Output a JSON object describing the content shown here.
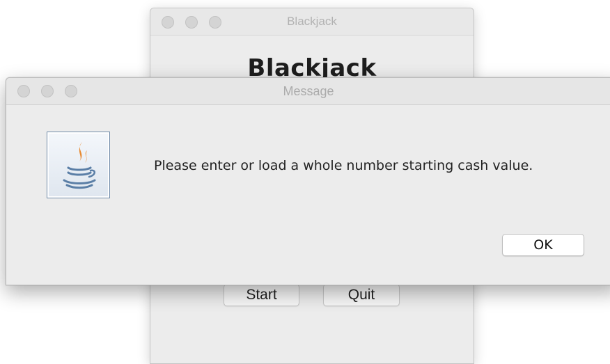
{
  "background_window": {
    "title": "Blackjack",
    "heading": "Blackjack",
    "buttons": {
      "start": "Start",
      "quit": "Quit"
    }
  },
  "dialog": {
    "title": "Message",
    "icon": "java-logo-icon",
    "message": "Please enter or load a whole number starting cash value.",
    "ok_label": "OK"
  },
  "colors": {
    "window_bg": "#ececec",
    "traffic_inactive": "#d4d4d4",
    "java_orange": "#e8892e",
    "java_blue": "#5a7ea6"
  }
}
